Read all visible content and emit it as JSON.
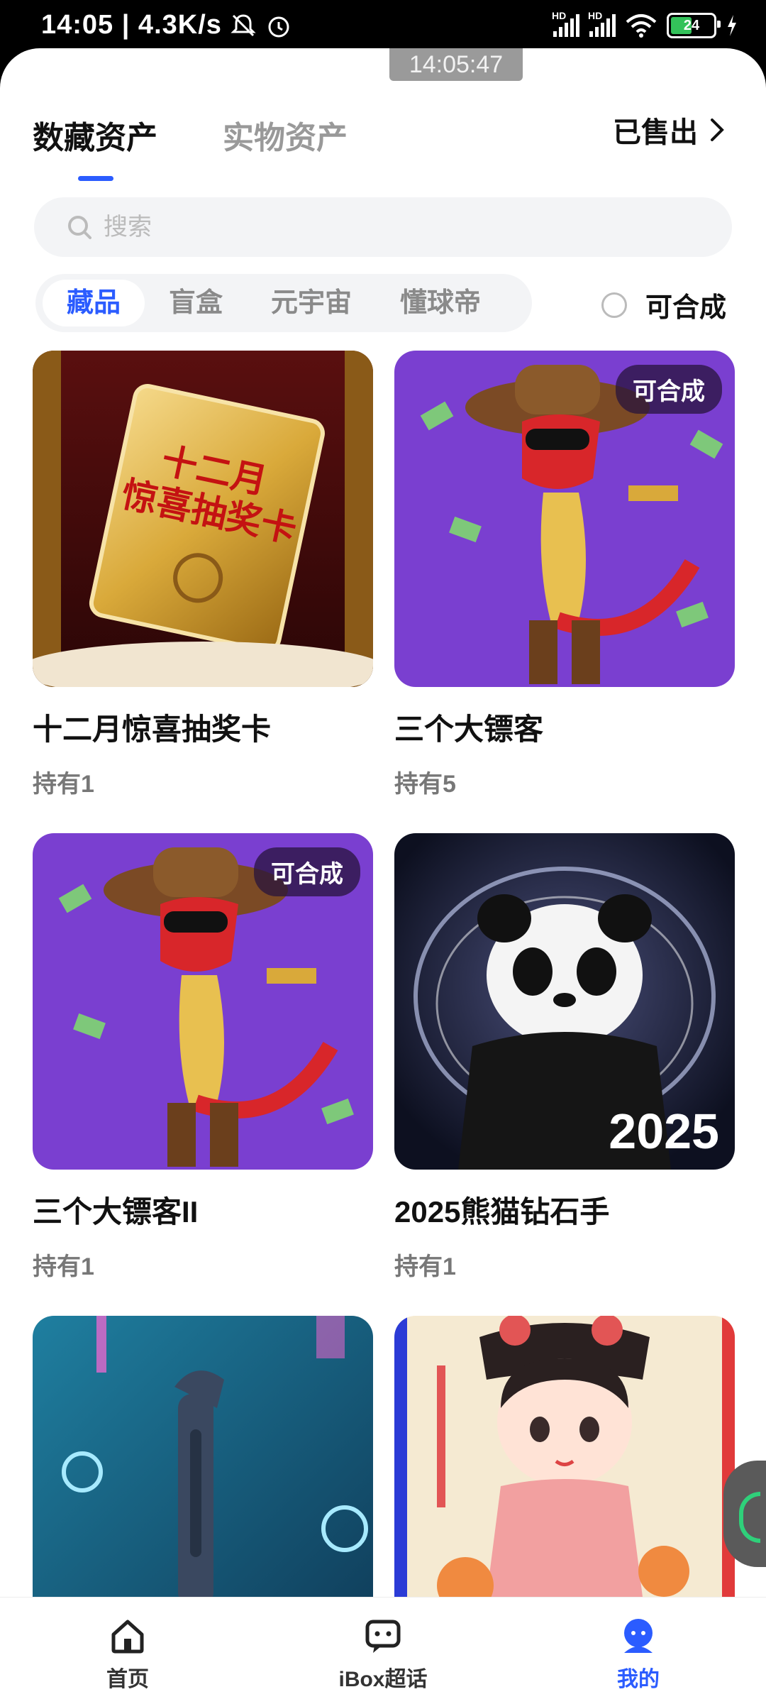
{
  "status_bar": {
    "time_speed": "14:05 | 4.3K/s",
    "hd1": "HD",
    "hd2": "HD",
    "battery": "24"
  },
  "overlay_time": "14:05:47",
  "tabs": [
    {
      "label": "数藏资产"
    },
    {
      "label": "实物资产"
    }
  ],
  "sold_link": "已售出",
  "search": {
    "placeholder": "搜索"
  },
  "categories": [
    {
      "label": "藏品"
    },
    {
      "label": "盲盒"
    },
    {
      "label": "元宇宙"
    },
    {
      "label": "懂球帝"
    }
  ],
  "synth_filter": "可合成",
  "cards": [
    {
      "name": "十二月惊喜抽奖卡",
      "holding": "持有1",
      "art_text": "十二月\n惊喜抽奖卡"
    },
    {
      "name": "三个大镖客",
      "holding": "持有5",
      "badge": "可合成"
    },
    {
      "name": "三个大镖客II",
      "holding": "持有1",
      "badge": "可合成"
    },
    {
      "name": "2025熊猫钻石手",
      "holding": "持有1",
      "art_text": "2025"
    },
    {
      "name": "",
      "holding": ""
    },
    {
      "name": "",
      "holding": ""
    }
  ],
  "bottom_nav": [
    {
      "label": "首页",
      "icon": "home-icon"
    },
    {
      "label": "iBox超话",
      "icon": "chat-icon"
    },
    {
      "label": "我的",
      "icon": "profile-icon"
    }
  ],
  "colors": {
    "accent": "#2b5cff",
    "badge_bg": "#281440"
  }
}
